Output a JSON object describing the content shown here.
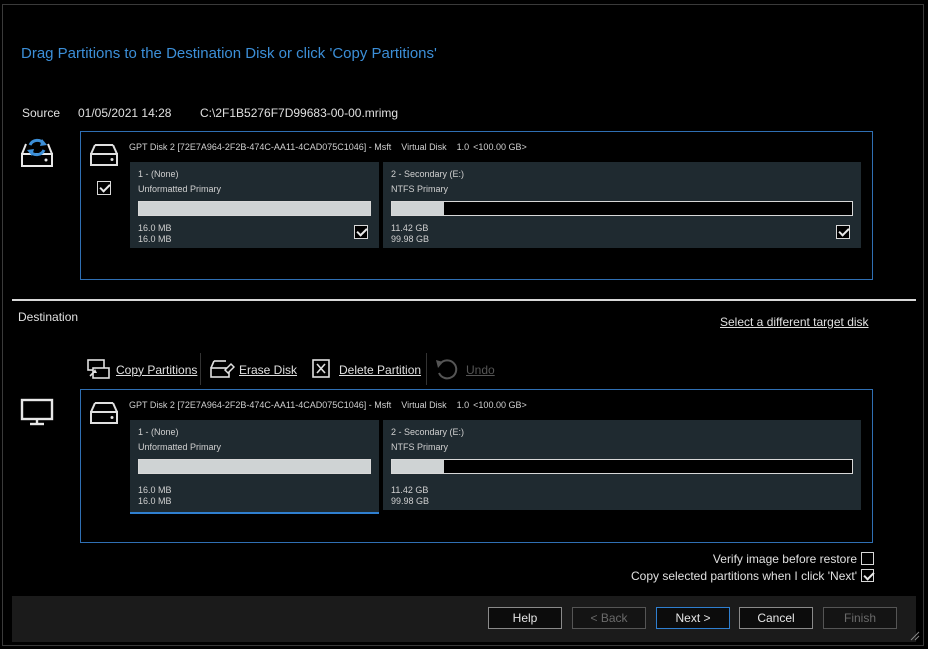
{
  "header": {
    "title": "Drag Partitions to the Destination Disk or click 'Copy Partitions'"
  },
  "source": {
    "label": "Source",
    "date": "01/05/2021 14:28",
    "path": "C:\\2F1B5276F7D99683-00-00.mrimg",
    "disk": {
      "name": "GPT Disk 2 [72E7A964-2F2B-474C-AA11-4CAD075C1046] - Msft",
      "type": "Virtual Disk",
      "version": "1.0",
      "size": "<100.00 GB>",
      "checked": true
    },
    "partitions": [
      {
        "name": "1 - (None)",
        "type": "Unformatted Primary",
        "used": "16.0 MB",
        "total": "16.0 MB",
        "fill": 1.0,
        "checked": true
      },
      {
        "name": "2 - Secondary (E:)",
        "type": "NTFS Primary",
        "used": "11.42 GB",
        "total": "99.98 GB",
        "fill": 0.114,
        "checked": true
      }
    ]
  },
  "destination": {
    "label": "Destination",
    "select_link": "Select a different target disk",
    "toolbar": {
      "copy": "Copy Partitions",
      "erase": "Erase Disk",
      "delete": "Delete Partition",
      "undo": "Undo"
    },
    "disk": {
      "name": "GPT Disk 2 [72E7A964-2F2B-474C-AA11-4CAD075C1046] - Msft",
      "type": "Virtual Disk",
      "version": "1.0",
      "size": "<100.00 GB>"
    },
    "partitions": [
      {
        "name": "1 - (None)",
        "type": "Unformatted Primary",
        "used": "16.0 MB",
        "total": "16.0 MB",
        "fill": 1.0
      },
      {
        "name": "2 - Secondary (E:)",
        "type": "NTFS Primary",
        "used": "11.42 GB",
        "total": "99.98 GB",
        "fill": 0.114
      }
    ]
  },
  "options": {
    "verify": {
      "label": "Verify image before restore",
      "checked": false
    },
    "copy_selected": {
      "label": "Copy selected partitions when I click 'Next'",
      "checked": true
    }
  },
  "footer": {
    "help": "Help",
    "back": "< Back",
    "next": "Next >",
    "cancel": "Cancel",
    "finish": "Finish"
  },
  "colors": {
    "accent": "#3c8fd8",
    "border": "#2f6fb3",
    "partition_bg": "#1f2a30"
  }
}
